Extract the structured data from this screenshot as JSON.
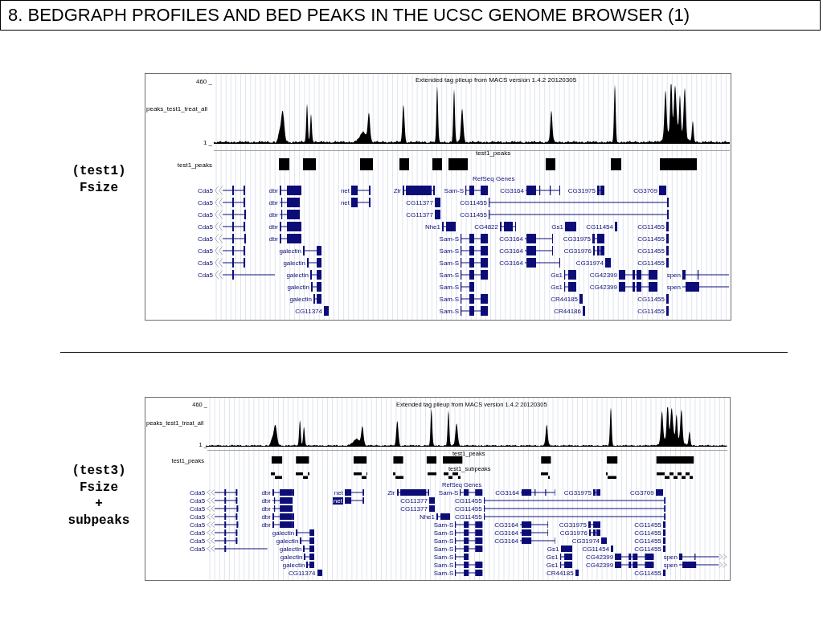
{
  "title": "8. BEDGRAPH PROFILES AND BED PEAKS IN THE UCSC GENOME BROWSER (1)",
  "panels": [
    {
      "caption": [
        "(test1)",
        "Fsize"
      ],
      "browser": {
        "signal": {
          "axis_max": "460 _",
          "axis_min": "1 _",
          "label": "peaks_test1_treat_all",
          "title": "Extended tag pileup from MACS version 1.4.2 20120305"
        },
        "tracks": [
          {
            "kind": "peaks",
            "label": "test1_peaks",
            "center_label": "test1_peaks"
          }
        ],
        "genes": {
          "label": "RefSeq Genes",
          "rows": [
            {
              "genes": [
                {
                  "name": "Cda5",
                  "highlighted": false
                },
                {
                  "name": "dbr",
                  "highlighted": false
                },
                {
                  "name": "net",
                  "highlighted": false
                },
                {
                  "name": "Zir",
                  "highlighted": false
                },
                {
                  "name": "Sam-S",
                  "highlighted": false
                },
                {
                  "name": "CG3164",
                  "highlighted": false
                },
                {
                  "name": "CG31975",
                  "highlighted": false
                },
                {
                  "name": "CG3709",
                  "highlighted": false
                }
              ]
            },
            {
              "genes": [
                {
                  "name": "Cda5",
                  "highlighted": false
                },
                {
                  "name": "dbr",
                  "highlighted": false
                },
                {
                  "name": "net",
                  "highlighted": false
                },
                {
                  "name": "CG11377",
                  "highlighted": false
                },
                {
                  "name": "CG11455",
                  "highlighted": false
                }
              ]
            },
            {
              "genes": [
                {
                  "name": "Cda5",
                  "highlighted": false
                },
                {
                  "name": "dbr",
                  "highlighted": false
                },
                {
                  "name": "CG11377",
                  "highlighted": false
                },
                {
                  "name": "CG11455",
                  "highlighted": false
                }
              ]
            },
            {
              "genes": [
                {
                  "name": "Cda5",
                  "highlighted": false
                },
                {
                  "name": "dbr",
                  "highlighted": false
                },
                {
                  "name": "Nhe1",
                  "highlighted": false
                },
                {
                  "name": "CG4822",
                  "highlighted": false
                },
                {
                  "name": "Gs1",
                  "highlighted": false
                },
                {
                  "name": "CG11454",
                  "highlighted": false
                },
                {
                  "name": "CG11455",
                  "highlighted": false
                }
              ]
            },
            {
              "genes": [
                {
                  "name": "Cda5",
                  "highlighted": false
                },
                {
                  "name": "dbr",
                  "highlighted": false
                },
                {
                  "name": "Sam-S",
                  "highlighted": false
                },
                {
                  "name": "CG3164",
                  "highlighted": false
                },
                {
                  "name": "CG31975",
                  "highlighted": false
                },
                {
                  "name": "CG11455",
                  "highlighted": false
                }
              ]
            },
            {
              "genes": [
                {
                  "name": "Cda5",
                  "highlighted": false
                },
                {
                  "name": "galectin",
                  "highlighted": false
                },
                {
                  "name": "Sam-S",
                  "highlighted": false
                },
                {
                  "name": "CG3164",
                  "highlighted": false
                },
                {
                  "name": "CG31976",
                  "highlighted": false
                },
                {
                  "name": "CG11455",
                  "highlighted": false
                }
              ]
            },
            {
              "genes": [
                {
                  "name": "Cda5",
                  "highlighted": false
                },
                {
                  "name": "galectin",
                  "highlighted": false
                },
                {
                  "name": "Sam-S",
                  "highlighted": false
                },
                {
                  "name": "CG3164",
                  "highlighted": false
                },
                {
                  "name": "CG31974",
                  "highlighted": false
                },
                {
                  "name": "CG11455",
                  "highlighted": false
                }
              ]
            },
            {
              "genes": [
                {
                  "name": "Cda5",
                  "highlighted": false
                },
                {
                  "name": "galectin",
                  "highlighted": false
                },
                {
                  "name": "Sam-S",
                  "highlighted": false
                },
                {
                  "name": "Gs1",
                  "highlighted": false
                },
                {
                  "name": "CG42399",
                  "highlighted": false
                },
                {
                  "name": "spen",
                  "highlighted": false
                }
              ]
            },
            {
              "genes": [
                {
                  "name": "galectin",
                  "highlighted": false
                },
                {
                  "name": "Sam-S",
                  "highlighted": false
                },
                {
                  "name": "Gs1",
                  "highlighted": false
                },
                {
                  "name": "CG42399",
                  "highlighted": false
                },
                {
                  "name": "spen",
                  "highlighted": false
                }
              ]
            },
            {
              "genes": [
                {
                  "name": "galectin",
                  "highlighted": false
                },
                {
                  "name": "Sam-S",
                  "highlighted": false
                },
                {
                  "name": "CR44185",
                  "highlighted": false
                },
                {
                  "name": "CG11455",
                  "highlighted": false
                }
              ]
            },
            {
              "genes": [
                {
                  "name": "CG11374",
                  "highlighted": false
                },
                {
                  "name": "Sam-S",
                  "highlighted": false
                },
                {
                  "name": "CR44186",
                  "highlighted": false
                },
                {
                  "name": "CG11455",
                  "highlighted": false
                }
              ]
            }
          ]
        }
      }
    },
    {
      "caption": [
        "(test3)",
        "Fsize",
        "+",
        "subpeaks"
      ],
      "browser": {
        "signal": {
          "axis_max": "460 _",
          "axis_min": "1 _",
          "label": "peaks_test1_treat_all",
          "title": "Extended tag pileup from MACS version 1.4.2 20120305"
        },
        "tracks": [
          {
            "kind": "peaks",
            "label": "test1_peaks",
            "center_label": "test1_peaks"
          },
          {
            "kind": "subpeaks",
            "center_label": "test1_subpeaks"
          }
        ],
        "genes": {
          "label": "RefSeq Genes",
          "rows": [
            {
              "genes": [
                {
                  "name": "Cda5",
                  "highlighted": false
                },
                {
                  "name": "dbr",
                  "highlighted": false
                },
                {
                  "name": "net",
                  "highlighted": false
                },
                {
                  "name": "Zir",
                  "highlighted": false
                },
                {
                  "name": "Sam-S",
                  "highlighted": false
                },
                {
                  "name": "CG3164",
                  "highlighted": false
                },
                {
                  "name": "CG31975",
                  "highlighted": false
                },
                {
                  "name": "CG3709",
                  "highlighted": false
                }
              ]
            },
            {
              "genes": [
                {
                  "name": "Cda5",
                  "highlighted": false
                },
                {
                  "name": "dbr",
                  "highlighted": false
                },
                {
                  "name": "net",
                  "highlighted": true
                },
                {
                  "name": "CG11377",
                  "highlighted": false
                },
                {
                  "name": "CG11455",
                  "highlighted": false
                }
              ]
            },
            {
              "genes": [
                {
                  "name": "Cda5",
                  "highlighted": false
                },
                {
                  "name": "dbr",
                  "highlighted": false
                },
                {
                  "name": "CG11377",
                  "highlighted": false
                },
                {
                  "name": "CG11455",
                  "highlighted": false
                }
              ]
            },
            {
              "genes": [
                {
                  "name": "Cda5",
                  "highlighted": false
                },
                {
                  "name": "dbr",
                  "highlighted": false
                },
                {
                  "name": "Nhe1",
                  "highlighted": false
                },
                {
                  "name": "CG11455",
                  "highlighted": false
                }
              ]
            },
            {
              "genes": [
                {
                  "name": "Cda5",
                  "highlighted": false
                },
                {
                  "name": "dbr",
                  "highlighted": false
                },
                {
                  "name": "Sam-S",
                  "highlighted": false
                },
                {
                  "name": "CG3164",
                  "highlighted": false
                },
                {
                  "name": "CG31975",
                  "highlighted": false
                },
                {
                  "name": "CG11455",
                  "highlighted": false
                }
              ]
            },
            {
              "genes": [
                {
                  "name": "Cda5",
                  "highlighted": false
                },
                {
                  "name": "galectin",
                  "highlighted": false
                },
                {
                  "name": "Sam-S",
                  "highlighted": false
                },
                {
                  "name": "CG3164",
                  "highlighted": false
                },
                {
                  "name": "CG31976",
                  "highlighted": false
                },
                {
                  "name": "CG11455",
                  "highlighted": false
                }
              ]
            },
            {
              "genes": [
                {
                  "name": "Cda5",
                  "highlighted": false
                },
                {
                  "name": "galectin",
                  "highlighted": false
                },
                {
                  "name": "Sam-S",
                  "highlighted": false
                },
                {
                  "name": "CG3164",
                  "highlighted": false
                },
                {
                  "name": "CG31974",
                  "highlighted": false
                },
                {
                  "name": "CG11455",
                  "highlighted": false
                }
              ]
            },
            {
              "genes": [
                {
                  "name": "Cda5",
                  "highlighted": false
                },
                {
                  "name": "galectin",
                  "highlighted": false
                },
                {
                  "name": "Sam-S",
                  "highlighted": false
                },
                {
                  "name": "Gs1",
                  "highlighted": false
                },
                {
                  "name": "CG11454",
                  "highlighted": false
                },
                {
                  "name": "CG11455",
                  "highlighted": false
                }
              ]
            },
            {
              "genes": [
                {
                  "name": "galectin",
                  "highlighted": false
                },
                {
                  "name": "Sam-S",
                  "highlighted": false
                },
                {
                  "name": "Gs1",
                  "highlighted": false
                },
                {
                  "name": "CG42399",
                  "highlighted": false
                },
                {
                  "name": "spen",
                  "highlighted": false
                }
              ]
            },
            {
              "genes": [
                {
                  "name": "galectin",
                  "highlighted": false
                },
                {
                  "name": "Sam-S",
                  "highlighted": false
                },
                {
                  "name": "Gs1",
                  "highlighted": false
                },
                {
                  "name": "CG42399",
                  "highlighted": false
                },
                {
                  "name": "spen",
                  "highlighted": false
                }
              ]
            },
            {
              "genes": [
                {
                  "name": "CG11374",
                  "highlighted": false
                },
                {
                  "name": "Sam-S",
                  "highlighted": false
                },
                {
                  "name": "CR44185",
                  "highlighted": false
                },
                {
                  "name": "CG11455",
                  "highlighted": false
                }
              ]
            }
          ]
        }
      }
    }
  ]
}
